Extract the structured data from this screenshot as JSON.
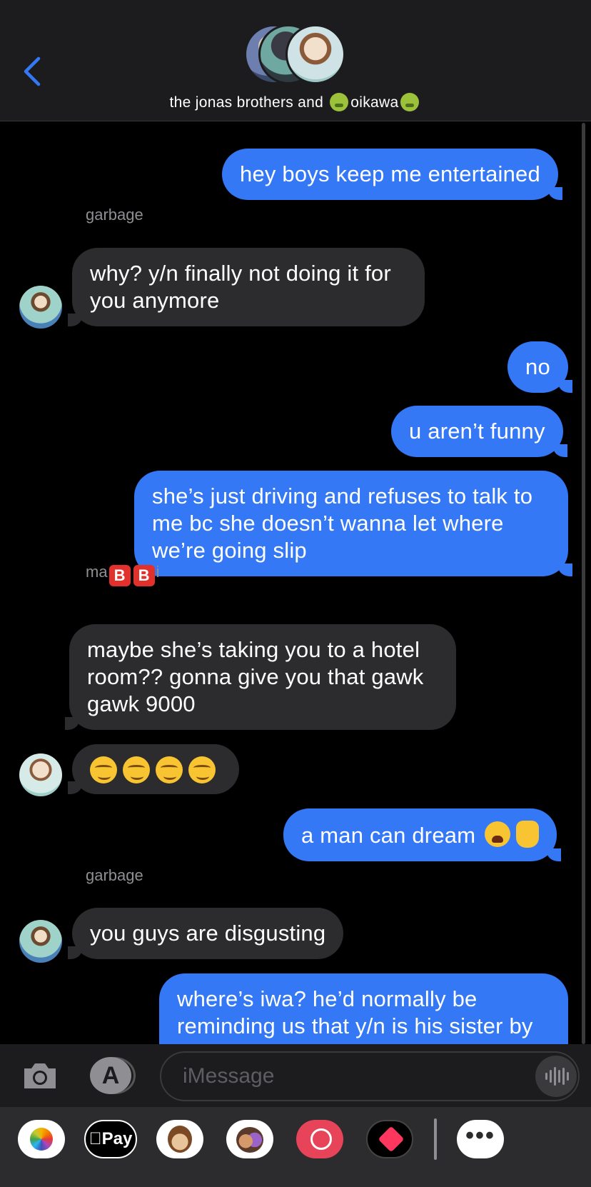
{
  "header": {
    "title_prefix": "the jonas brothers and",
    "title_name": "oikawa",
    "back_label": "back"
  },
  "messages": [
    {
      "type": "sent",
      "text": "hey boys keep me entertained"
    },
    {
      "type": "sender",
      "text": "garbage"
    },
    {
      "type": "received",
      "text": "why? y/n finally not doing it for you anymore"
    },
    {
      "type": "sent",
      "text": "no"
    },
    {
      "type": "sent",
      "text": "u aren’t funny"
    },
    {
      "type": "sent",
      "text": "she’s just driving and refuses to talk to me bc she doesn’t wanna let where we’re going slip"
    },
    {
      "type": "sender",
      "text_a": "ma",
      "text_b1": "B",
      "text_b2": "B",
      "text_c": "i"
    },
    {
      "type": "received",
      "text": "maybe she’s taking you to a hotel room?? gonna give you that gawk gawk 9000"
    },
    {
      "type": "received",
      "emoji": "smirking-face x4"
    },
    {
      "type": "sent",
      "text": "a man can dream"
    },
    {
      "type": "sender",
      "text": "garbage"
    },
    {
      "type": "received",
      "text": "you guys are disgusting"
    },
    {
      "type": "sent",
      "text": "where’s iwa? he’d normally be reminding us that y/n is his sister by"
    }
  ],
  "input": {
    "placeholder": "iMessage"
  },
  "drawer": {
    "apple_pay_label": "Pay",
    "more_label": "•••"
  },
  "icons": {
    "back": "chevron-left-icon",
    "camera": "camera-icon",
    "appstore": "app-store-icon",
    "voice": "waveform-icon"
  },
  "colors": {
    "sent_bubble": "#3478f6",
    "received_bubble": "#2c2c2e",
    "accent": "#3478f6"
  }
}
